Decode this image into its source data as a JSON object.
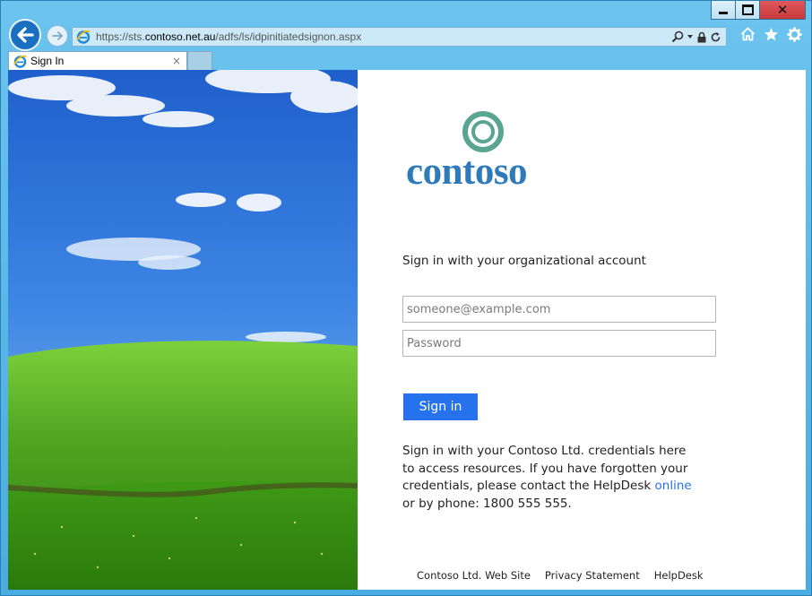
{
  "browser": {
    "address": {
      "scheme": "https://sts.",
      "domain": "contoso.net.au",
      "path": "/adfs/ls/idpinitiatedsignon.aspx"
    },
    "tab": {
      "title": "Sign In",
      "close": "×"
    },
    "window_controls": {
      "close": "✕"
    }
  },
  "page": {
    "logo_text": "contoso",
    "heading": "Sign in with your organizational account",
    "email_placeholder": "someone@example.com",
    "password_placeholder": "Password",
    "signin_label": "Sign in",
    "help_before": "Sign in with your Contoso Ltd. credentials here to access resources. If you have forgotten your credentials, please contact the HelpDesk ",
    "help_link": "online",
    "help_after": " or by phone: 1800 555 555.",
    "footer": {
      "website": "Contoso Ltd. Web Site",
      "privacy": "Privacy Statement",
      "helpdesk": "HelpDesk"
    }
  },
  "colors": {
    "accent": "#2672ec",
    "logo_blue": "#2f7bba",
    "logo_teal": "#5aa58f",
    "chrome": "#5bb7e6"
  },
  "icons": [
    "back-arrow-icon",
    "forward-arrow-icon",
    "ie-favicon-icon",
    "search-icon",
    "lock-icon",
    "refresh-icon",
    "home-icon",
    "favorites-star-icon",
    "settings-gear-icon"
  ]
}
